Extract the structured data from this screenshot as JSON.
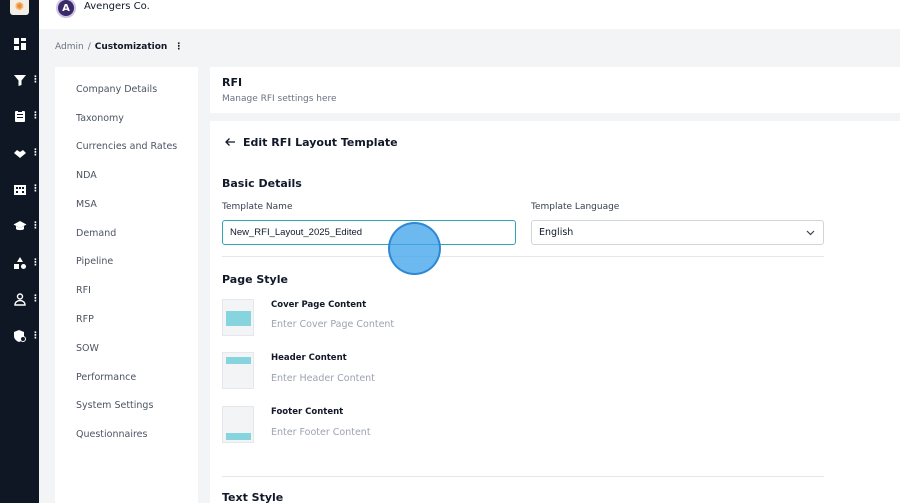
{
  "app": {
    "company_name": "Avengers Co.",
    "company_initial": "A"
  },
  "rail": {
    "icons": [
      "dashboard-icon",
      "filter-icon",
      "clipboard-icon",
      "handshake-icon",
      "building-icon",
      "graduation-cap-icon",
      "shapes-icon",
      "user-icon",
      "shield-settings-icon"
    ]
  },
  "breadcrumb": {
    "root": "Admin",
    "separator": "/",
    "current": "Customization"
  },
  "settings_nav": {
    "items": [
      {
        "label": "Company Details"
      },
      {
        "label": "Taxonomy"
      },
      {
        "label": "Currencies and Rates"
      },
      {
        "label": "NDA"
      },
      {
        "label": "MSA"
      },
      {
        "label": "Demand"
      },
      {
        "label": "Pipeline"
      },
      {
        "label": "RFI"
      },
      {
        "label": "RFP"
      },
      {
        "label": "SOW"
      },
      {
        "label": "Performance"
      },
      {
        "label": "System Settings"
      },
      {
        "label": "Questionnaires"
      }
    ]
  },
  "rfi_header": {
    "title": "RFI",
    "subtitle": "Manage RFI settings here"
  },
  "form": {
    "title": "Edit RFI Layout Template",
    "basic_details": {
      "heading": "Basic Details",
      "template_name_label": "Template Name",
      "template_name_value": "New_RFI_Layout_2025_Edited",
      "template_language_label": "Template Language",
      "template_language_value": "English"
    },
    "page_style": {
      "heading": "Page Style",
      "cover": {
        "label": "Cover Page Content",
        "placeholder": "Enter Cover Page Content"
      },
      "header": {
        "label": "Header Content",
        "placeholder": "Enter Header Content"
      },
      "footer": {
        "label": "Footer Content",
        "placeholder": "Enter Footer Content"
      }
    },
    "text_style": {
      "heading": "Text Style"
    }
  },
  "colors": {
    "rail_bg": "#0f1724",
    "accent": "#2ea6b6",
    "thumb_band": "#86d5de",
    "cursor": "#42a5eb"
  }
}
